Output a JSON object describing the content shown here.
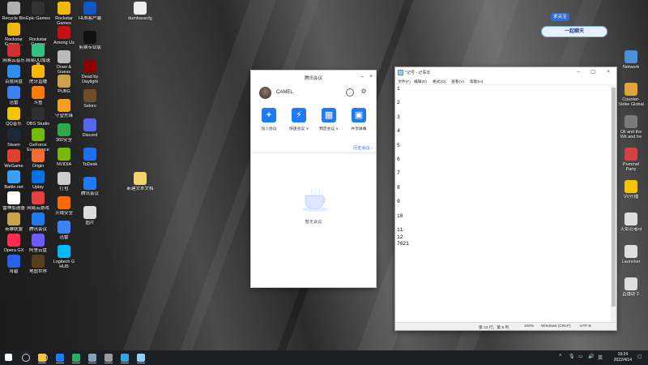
{
  "desktop": {
    "icons_left_col1": [
      {
        "label": "Recycle Bin",
        "color": "#b0b0b0"
      },
      {
        "label": "Rockstar Games...",
        "color": "#f2b90c"
      },
      {
        "label": "网易云音乐",
        "color": "#d32f2f"
      },
      {
        "label": "百度网盘",
        "color": "#2f8cf0"
      },
      {
        "label": "迅雷",
        "color": "#3b82f6"
      },
      {
        "label": "QQ音乐",
        "color": "#f5c400"
      },
      {
        "label": "Steam",
        "color": "#1b2838"
      },
      {
        "label": "WeGame",
        "color": "#e0402e"
      },
      {
        "label": "Battle.net",
        "color": "#3aa0ff"
      },
      {
        "label": "雷神加速器",
        "color": "#ffffff"
      },
      {
        "label": "英雄联盟",
        "color": "#c9a34a"
      },
      {
        "label": "Opera GX",
        "color": "#ff2a4d"
      },
      {
        "label": "育碧",
        "color": "#2563eb"
      }
    ],
    "icons_left_col2": [
      {
        "label": "Epic Games",
        "color": "#333333"
      },
      {
        "label": "Rockstar Games Launcher",
        "color": "#222222"
      },
      {
        "label": "网易UU加速器",
        "color": "#31c27c"
      },
      {
        "label": "虎牙直播",
        "color": "#f8b600"
      },
      {
        "label": "斗鱼",
        "color": "#ff7a00"
      },
      {
        "label": "OBS Studio",
        "color": "#302e31"
      },
      {
        "label": "GeForce Experience",
        "color": "#76b900"
      },
      {
        "label": "Origin",
        "color": "#f56c2d"
      },
      {
        "label": "Uplay",
        "color": "#0073e6"
      },
      {
        "label": "网易云游戏",
        "color": "#e83e3e"
      },
      {
        "label": "腾讯会议",
        "color": "#1e7bf5"
      },
      {
        "label": "阿里云盘",
        "color": "#6b5cff"
      },
      {
        "label": "地图世界",
        "color": "#5a3e1b"
      }
    ],
    "icons_left_col3": [
      {
        "label": "Rockstar Games",
        "color": "#f2b90c"
      },
      {
        "label": "Among Us",
        "color": "#c51111"
      },
      {
        "label": "Draw & Guess",
        "color": "#bbbbbb"
      },
      {
        "label": "PUBG",
        "color": "#cfa24a"
      },
      {
        "label": "守望先锋",
        "color": "#f99e1a"
      },
      {
        "label": "360安全",
        "color": "#2aa84a"
      },
      {
        "label": "NVIDIA",
        "color": "#76b900"
      },
      {
        "label": "打包",
        "color": "#cccccc"
      },
      {
        "label": "火绒安全",
        "color": "#ff6a00"
      },
      {
        "label": "迅雷",
        "color": "#3b82f6"
      },
      {
        "label": "Logitech G HUB",
        "color": "#00b8fc"
      }
    ],
    "icons_left_col4": [
      {
        "label": "HUB客户端",
        "color": "#0a58ca"
      },
      {
        "label": "剪映专业版",
        "color": "#111111"
      },
      {
        "label": "Dead by Daylight",
        "color": "#8b0000"
      },
      {
        "label": "Sekiro",
        "color": "#6b4f2a"
      },
      {
        "label": "Discord",
        "color": "#5865f2"
      },
      {
        "label": "ToDesk",
        "color": "#1d6ff2"
      },
      {
        "label": "腾讯会议",
        "color": "#1e7bf5"
      },
      {
        "label": "图片",
        "color": "#dddddd"
      }
    ],
    "icons_middle": [
      {
        "label": "dumbasscfg",
        "color": "#eeeeee"
      },
      {
        "label": "新建文本文档",
        "color": "#f5d36b"
      }
    ],
    "icons_right": [
      {
        "label": "Network",
        "color": "#4a90d9"
      },
      {
        "label": "Counter-Strike Global Off...",
        "color": "#e1a33b"
      },
      {
        "label": "Oil and the Wit and Ire",
        "color": "#7a7a7a"
      },
      {
        "label": "Pummel Party",
        "color": "#d94040"
      },
      {
        "label": "VV开播",
        "color": "#f5c400"
      },
      {
        "label": "火影忍者ol",
        "color": "#dddddd"
      },
      {
        "label": "Launcher",
        "color": "#dddddd"
      },
      {
        "label": "直播助手",
        "color": "#dddddd"
      }
    ]
  },
  "overlay": {
    "chip": "求关注",
    "badge": "一起聊天"
  },
  "tencent_meeting": {
    "title": "腾讯会议",
    "username": "CAMEL",
    "actions": [
      {
        "label": "加入会议",
        "icon": "plus-icon",
        "glyph": "+"
      },
      {
        "label": "快速会议 ∨",
        "icon": "lightning-icon",
        "glyph": "⚡"
      },
      {
        "label": "预定会议 ∨",
        "icon": "calendar-icon",
        "glyph": "▦"
      },
      {
        "label": "共享屏幕",
        "icon": "screen-share-icon",
        "glyph": "▣"
      }
    ],
    "history_link": "历史会议 ›",
    "empty_text": "暂无会议",
    "accent": "#1e7bf5"
  },
  "notepad": {
    "title": "*记号 - 记事本",
    "menus": [
      "文件(F)",
      "编辑(E)",
      "格式(O)",
      "查看(V)",
      "帮助(H)"
    ],
    "lines": [
      "1",
      "",
      "2",
      "",
      "3",
      "",
      "4",
      "",
      "5",
      "",
      "6",
      "",
      "7",
      "",
      "8",
      "",
      "9",
      "",
      "10",
      "",
      "11",
      "12",
      "7021"
    ],
    "status": {
      "position": "第 23 行，第 5 列",
      "zoom": "100%",
      "line_ending": "Windows (CRLF)",
      "encoding": "UTF-8"
    }
  },
  "taskbar": {
    "time": "19:24",
    "date": "2022/4/14",
    "items": [
      {
        "name": "start-button",
        "color": "#ffffff"
      },
      {
        "name": "search-button",
        "color": "#cccccc"
      },
      {
        "name": "task-view-button",
        "color": "#cccccc"
      },
      {
        "name": "taskbar-tencent-meeting",
        "color": "#1e7bf5"
      },
      {
        "name": "taskbar-file-explorer",
        "color": "#f5c542"
      },
      {
        "name": "taskbar-wechat",
        "color": "#2aae67"
      },
      {
        "name": "taskbar-steam",
        "color": "#8aa0b8"
      },
      {
        "name": "taskbar-obs",
        "color": "#9a9a9a"
      },
      {
        "name": "taskbar-edge",
        "color": "#2fa7e0"
      },
      {
        "name": "taskbar-notepad",
        "color": "#8fd0ff"
      }
    ]
  }
}
